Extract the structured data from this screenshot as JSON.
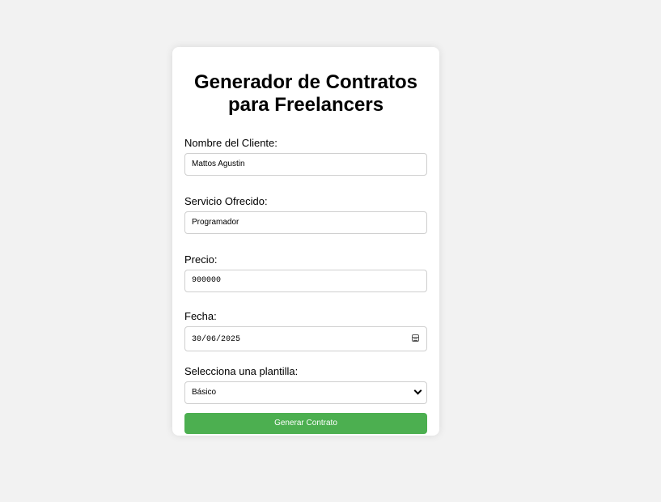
{
  "form": {
    "title_line1": "Generador de Contratos",
    "title_line2": "para Freelancers",
    "client": {
      "label": "Nombre del Cliente:",
      "value": "Mattos Agustin"
    },
    "service": {
      "label": "Servicio Ofrecido:",
      "value": "Programador"
    },
    "price": {
      "label": "Precio:",
      "value": "900000"
    },
    "date": {
      "label": "Fecha:",
      "value": "30/06/2025",
      "icon": "calendar-icon"
    },
    "template": {
      "label": "Selecciona una plantilla:",
      "selected": "Básico",
      "icon": "chevron-down-icon"
    },
    "submit_label": "Generar Contrato"
  },
  "colors": {
    "background": "#f2f2f2",
    "card": "#ffffff",
    "button": "#4caf50"
  }
}
